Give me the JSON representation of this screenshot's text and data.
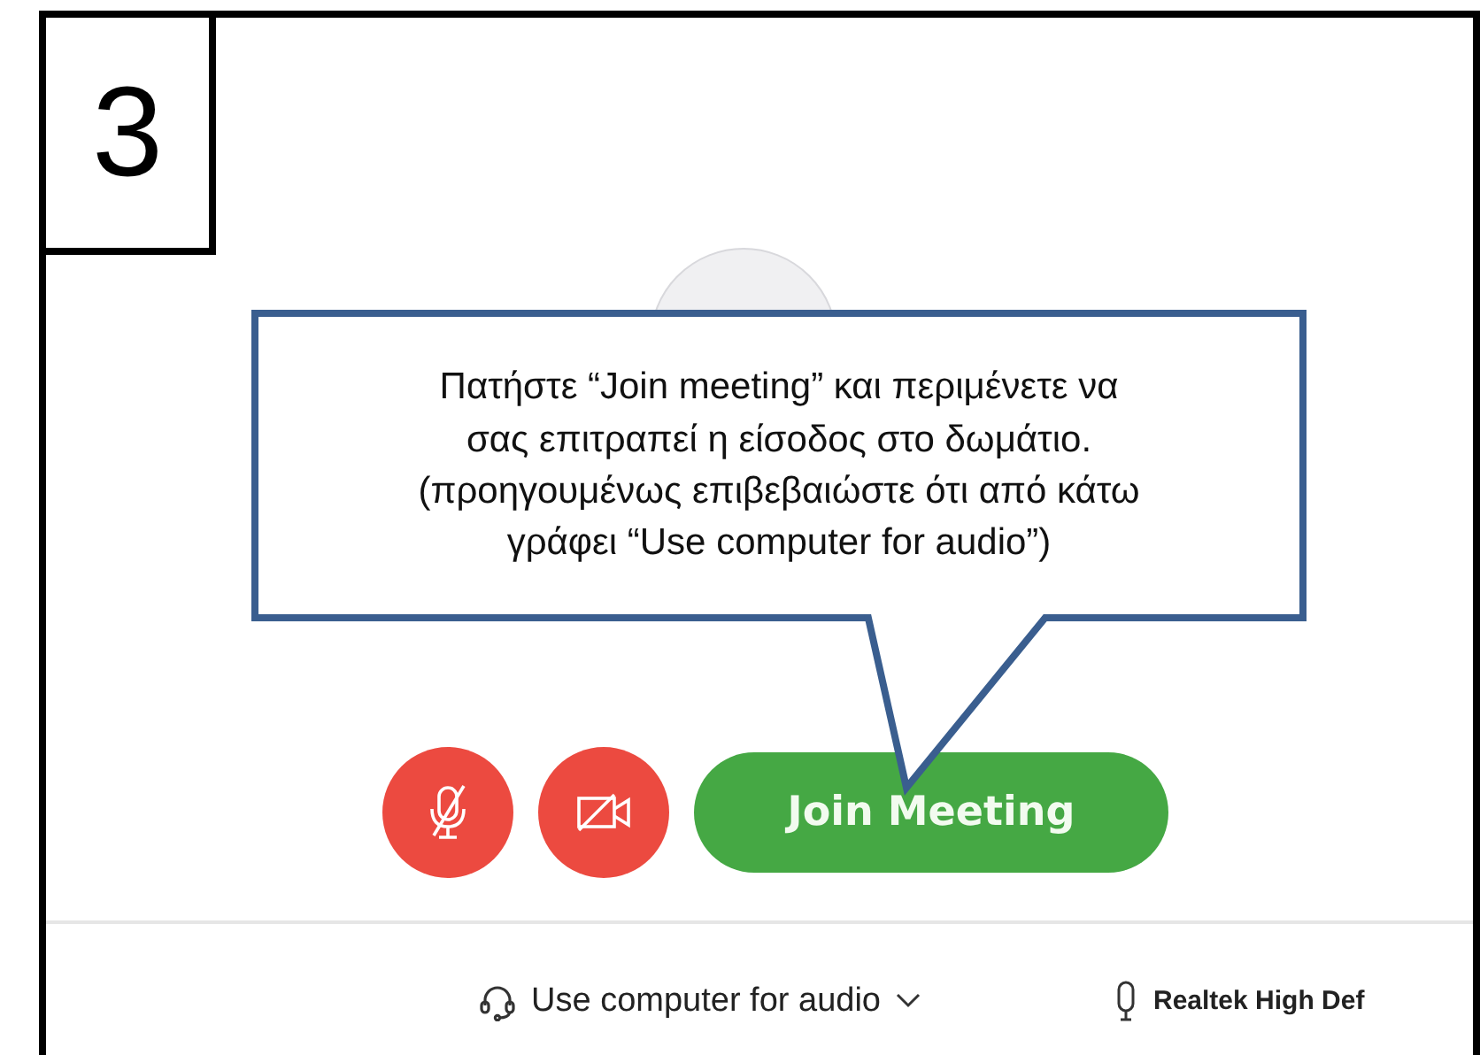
{
  "step_badge": "3",
  "callout": {
    "lines": [
      "Πατήστε “Join meeting” και περιμένετε να",
      "σας επιτραπεί η είσοδος στο δωμάτιο.",
      "(προηγουμένως επιβεβαιώστε ότι από κάτω",
      "γράφει “Use computer for audio”)"
    ]
  },
  "controls": {
    "mic_muted": true,
    "video_off": true,
    "join_label": "Join Meeting"
  },
  "audio": {
    "label": "Use computer for audio",
    "device": "Realtek High Def"
  }
}
